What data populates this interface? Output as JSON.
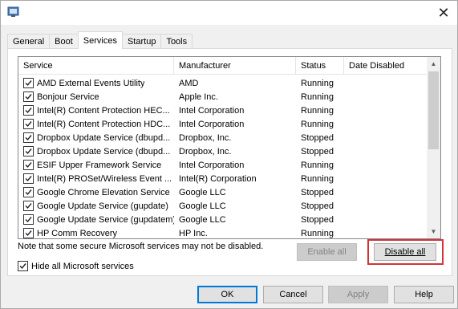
{
  "tabs": [
    {
      "label": "General"
    },
    {
      "label": "Boot"
    },
    {
      "label": "Services",
      "active": true
    },
    {
      "label": "Startup"
    },
    {
      "label": "Tools"
    }
  ],
  "columns": {
    "service": "Service",
    "manufacturer": "Manufacturer",
    "status": "Status",
    "date_disabled": "Date Disabled"
  },
  "services": [
    {
      "name": "AMD External Events Utility",
      "manufacturer": "AMD",
      "status": "Running",
      "checked": true
    },
    {
      "name": "Bonjour Service",
      "manufacturer": "Apple Inc.",
      "status": "Running",
      "checked": true
    },
    {
      "name": "Intel(R) Content Protection HEC...",
      "manufacturer": "Intel Corporation",
      "status": "Running",
      "checked": true
    },
    {
      "name": "Intel(R) Content Protection HDC...",
      "manufacturer": "Intel Corporation",
      "status": "Running",
      "checked": true
    },
    {
      "name": "Dropbox Update Service (dbupd...",
      "manufacturer": "Dropbox, Inc.",
      "status": "Stopped",
      "checked": true
    },
    {
      "name": "Dropbox Update Service (dbupd...",
      "manufacturer": "Dropbox, Inc.",
      "status": "Stopped",
      "checked": true
    },
    {
      "name": "ESIF Upper Framework Service",
      "manufacturer": "Intel Corporation",
      "status": "Running",
      "checked": true
    },
    {
      "name": "Intel(R) PROSet/Wireless Event ...",
      "manufacturer": "Intel(R) Corporation",
      "status": "Running",
      "checked": true
    },
    {
      "name": "Google Chrome Elevation Service",
      "manufacturer": "Google LLC",
      "status": "Stopped",
      "checked": true
    },
    {
      "name": "Google Update Service (gupdate)",
      "manufacturer": "Google LLC",
      "status": "Stopped",
      "checked": true
    },
    {
      "name": "Google Update Service (gupdatem)",
      "manufacturer": "Google LLC",
      "status": "Stopped",
      "checked": true
    },
    {
      "name": "HP Comm Recovery",
      "manufacturer": "HP Inc.",
      "status": "Running",
      "checked": true
    }
  ],
  "note": "Note that some secure Microsoft services may not be disabled.",
  "enable_all": "Enable all",
  "disable_all": "Disable all",
  "hide_ms_label": "Hide all Microsoft services",
  "hide_ms_checked": true,
  "buttons": {
    "ok": "OK",
    "cancel": "Cancel",
    "apply": "Apply",
    "help": "Help"
  },
  "colors": {
    "highlight": "#d13438",
    "primary_border": "#0078d7"
  },
  "icons": {
    "app": "msconfig-icon",
    "close": "close-icon",
    "scroll_up": "scroll-up-arrow-icon",
    "scroll_down": "scroll-down-arrow-icon",
    "check": "checkmark-icon"
  }
}
